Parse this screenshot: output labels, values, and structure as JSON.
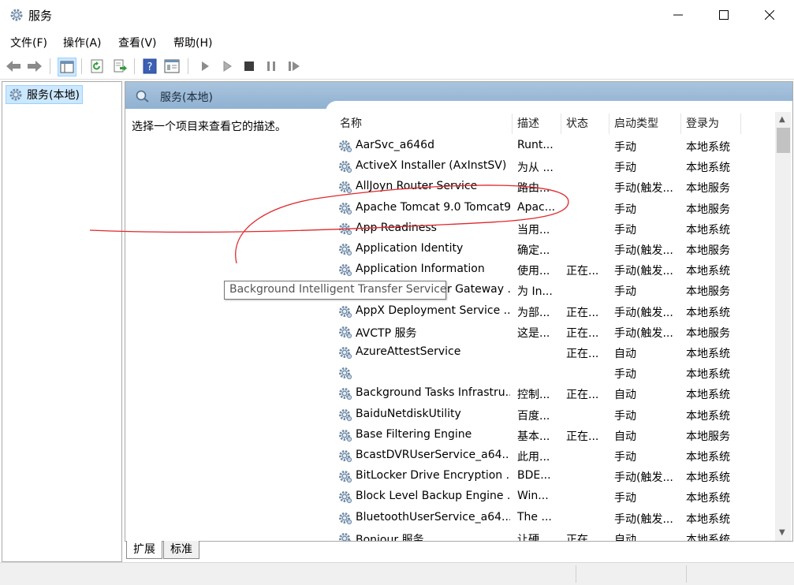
{
  "window": {
    "title": "服务"
  },
  "menu": [
    "文件(F)",
    "操作(A)",
    "查看(V)",
    "帮助(H)"
  ],
  "tree": {
    "root_label": "服务(本地)"
  },
  "panel": {
    "header": "服务(本地)",
    "description": "选择一个项目来查看它的描述。"
  },
  "columns": [
    "名称",
    "描述",
    "状态",
    "启动类型",
    "登录为"
  ],
  "services": [
    {
      "name": "AarSvc_a646d",
      "desc": "Runt...",
      "status": "",
      "startup": "手动",
      "logon": "本地系统"
    },
    {
      "name": "ActiveX Installer (AxInstSV)",
      "desc": "为从 ...",
      "status": "",
      "startup": "手动",
      "logon": "本地系统"
    },
    {
      "name": "AllJoyn Router Service",
      "desc": "路由...",
      "status": "",
      "startup": "手动(触发...",
      "logon": "本地服务"
    },
    {
      "name": "Apache Tomcat 9.0 Tomcat9",
      "desc": "Apac...",
      "status": "",
      "startup": "手动",
      "logon": "本地服务"
    },
    {
      "name": "App Readiness",
      "desc": "当用...",
      "status": "",
      "startup": "手动",
      "logon": "本地系统"
    },
    {
      "name": "Application Identity",
      "desc": "确定...",
      "status": "",
      "startup": "手动(触发...",
      "logon": "本地服务"
    },
    {
      "name": "Application Information",
      "desc": "使用...",
      "status": "正在...",
      "startup": "手动(触发...",
      "logon": "本地系统"
    },
    {
      "name": "Application Layer Gateway ...",
      "desc": "为 In...",
      "status": "",
      "startup": "手动",
      "logon": "本地服务"
    },
    {
      "name": "AppX Deployment Service ...",
      "desc": "为部...",
      "status": "正在...",
      "startup": "手动(触发...",
      "logon": "本地系统"
    },
    {
      "name": "AVCTP 服务",
      "desc": "这是...",
      "status": "正在...",
      "startup": "手动(触发...",
      "logon": "本地服务"
    },
    {
      "name": "AzureAttestService",
      "desc": "",
      "status": "正在...",
      "startup": "自动",
      "logon": "本地系统"
    },
    {
      "name": "",
      "desc": "",
      "status": "",
      "startup": "手动",
      "logon": "本地系统"
    },
    {
      "name": "Background Tasks Infrastru...",
      "desc": "控制...",
      "status": "正在...",
      "startup": "自动",
      "logon": "本地系统"
    },
    {
      "name": "BaiduNetdiskUtility",
      "desc": "百度...",
      "status": "",
      "startup": "手动",
      "logon": "本地系统"
    },
    {
      "name": "Base Filtering Engine",
      "desc": "基本...",
      "status": "正在...",
      "startup": "自动",
      "logon": "本地服务"
    },
    {
      "name": "BcastDVRUserService_a64...",
      "desc": "此用...",
      "status": "",
      "startup": "手动",
      "logon": "本地系统"
    },
    {
      "name": "BitLocker Drive Encryption ...",
      "desc": "BDE...",
      "status": "",
      "startup": "手动(触发...",
      "logon": "本地系统"
    },
    {
      "name": "Block Level Backup Engine ...",
      "desc": "Win...",
      "status": "",
      "startup": "手动",
      "logon": "本地系统"
    },
    {
      "name": "BluetoothUserService_a64...",
      "desc": "The ...",
      "status": "",
      "startup": "手动(触发...",
      "logon": "本地系统"
    },
    {
      "name": "Bonjour 服务",
      "desc": "让硬...",
      "status": "正在...",
      "startup": "自动",
      "logon": "本地系统"
    }
  ],
  "tooltip": "Background Intelligent Transfer Service",
  "tabs": [
    "扩展",
    "标准"
  ],
  "colors": {
    "selection": "#cce8ff",
    "header": "#9bbad8",
    "annotation": "#e0282c"
  }
}
